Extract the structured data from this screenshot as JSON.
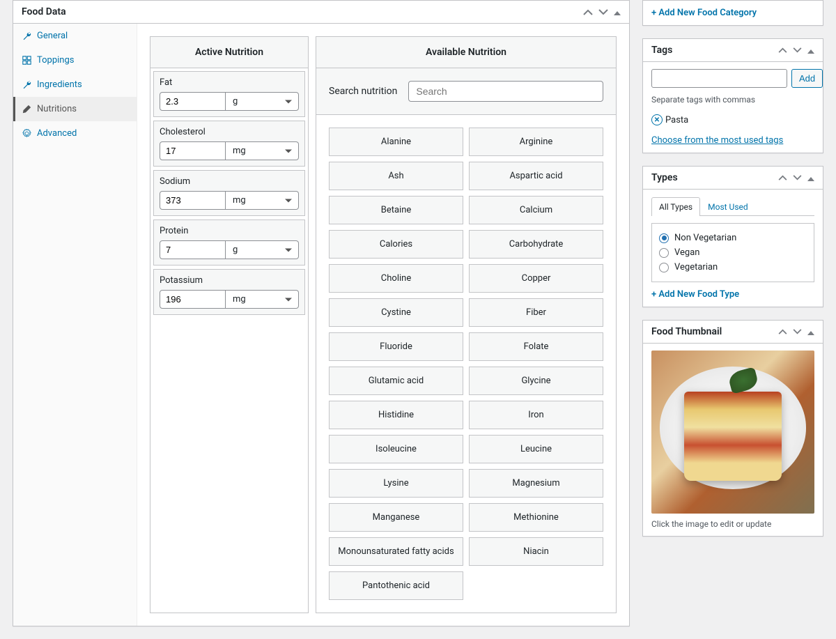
{
  "food_data": {
    "title": "Food Data",
    "sidebar": [
      {
        "label": "General",
        "icon": "wrench"
      },
      {
        "label": "Toppings",
        "icon": "grid"
      },
      {
        "label": "Ingredients",
        "icon": "wrench"
      },
      {
        "label": "Nutritions",
        "icon": "pencil",
        "active": true
      },
      {
        "label": "Advanced",
        "icon": "gear"
      }
    ],
    "active_nutrition": {
      "title": "Active Nutrition",
      "items": [
        {
          "label": "Fat",
          "value": "2.3",
          "unit": "g"
        },
        {
          "label": "Cholesterol",
          "value": "17",
          "unit": "mg"
        },
        {
          "label": "Sodium",
          "value": "373",
          "unit": "mg"
        },
        {
          "label": "Protein",
          "value": "7",
          "unit": "g"
        },
        {
          "label": "Potassium",
          "value": "196",
          "unit": "mg"
        }
      ]
    },
    "available_nutrition": {
      "title": "Available Nutrition",
      "search_label": "Search nutrition",
      "search_placeholder": "Search",
      "items": [
        "Alanine",
        "Arginine",
        "Ash",
        "Aspartic acid",
        "Betaine",
        "Calcium",
        "Calories",
        "Carbohydrate",
        "Choline",
        "Copper",
        "Cystine",
        "Fiber",
        "Fluoride",
        "Folate",
        "Glutamic acid",
        "Glycine",
        "Histidine",
        "Iron",
        "Isoleucine",
        "Leucine",
        "Lysine",
        "Magnesium",
        "Manganese",
        "Methionine",
        "Monounsaturated fatty acids",
        "Niacin",
        "Pantothenic acid"
      ]
    }
  },
  "category": {
    "add_link": "+ Add New Food Category"
  },
  "tags": {
    "title": "Tags",
    "add_button": "Add",
    "helper": "Separate tags with commas",
    "current": "Pasta",
    "most_used_link": "Choose from the most used tags"
  },
  "types": {
    "title": "Types",
    "tabs": [
      "All Types",
      "Most Used"
    ],
    "active_tab": 0,
    "options": [
      "Non Vegetarian",
      "Vegan",
      "Vegetarian"
    ],
    "selected": 0,
    "add_link": "+ Add New Food Type"
  },
  "thumbnail": {
    "title": "Food Thumbnail",
    "caption": "Click the image to edit or update"
  }
}
